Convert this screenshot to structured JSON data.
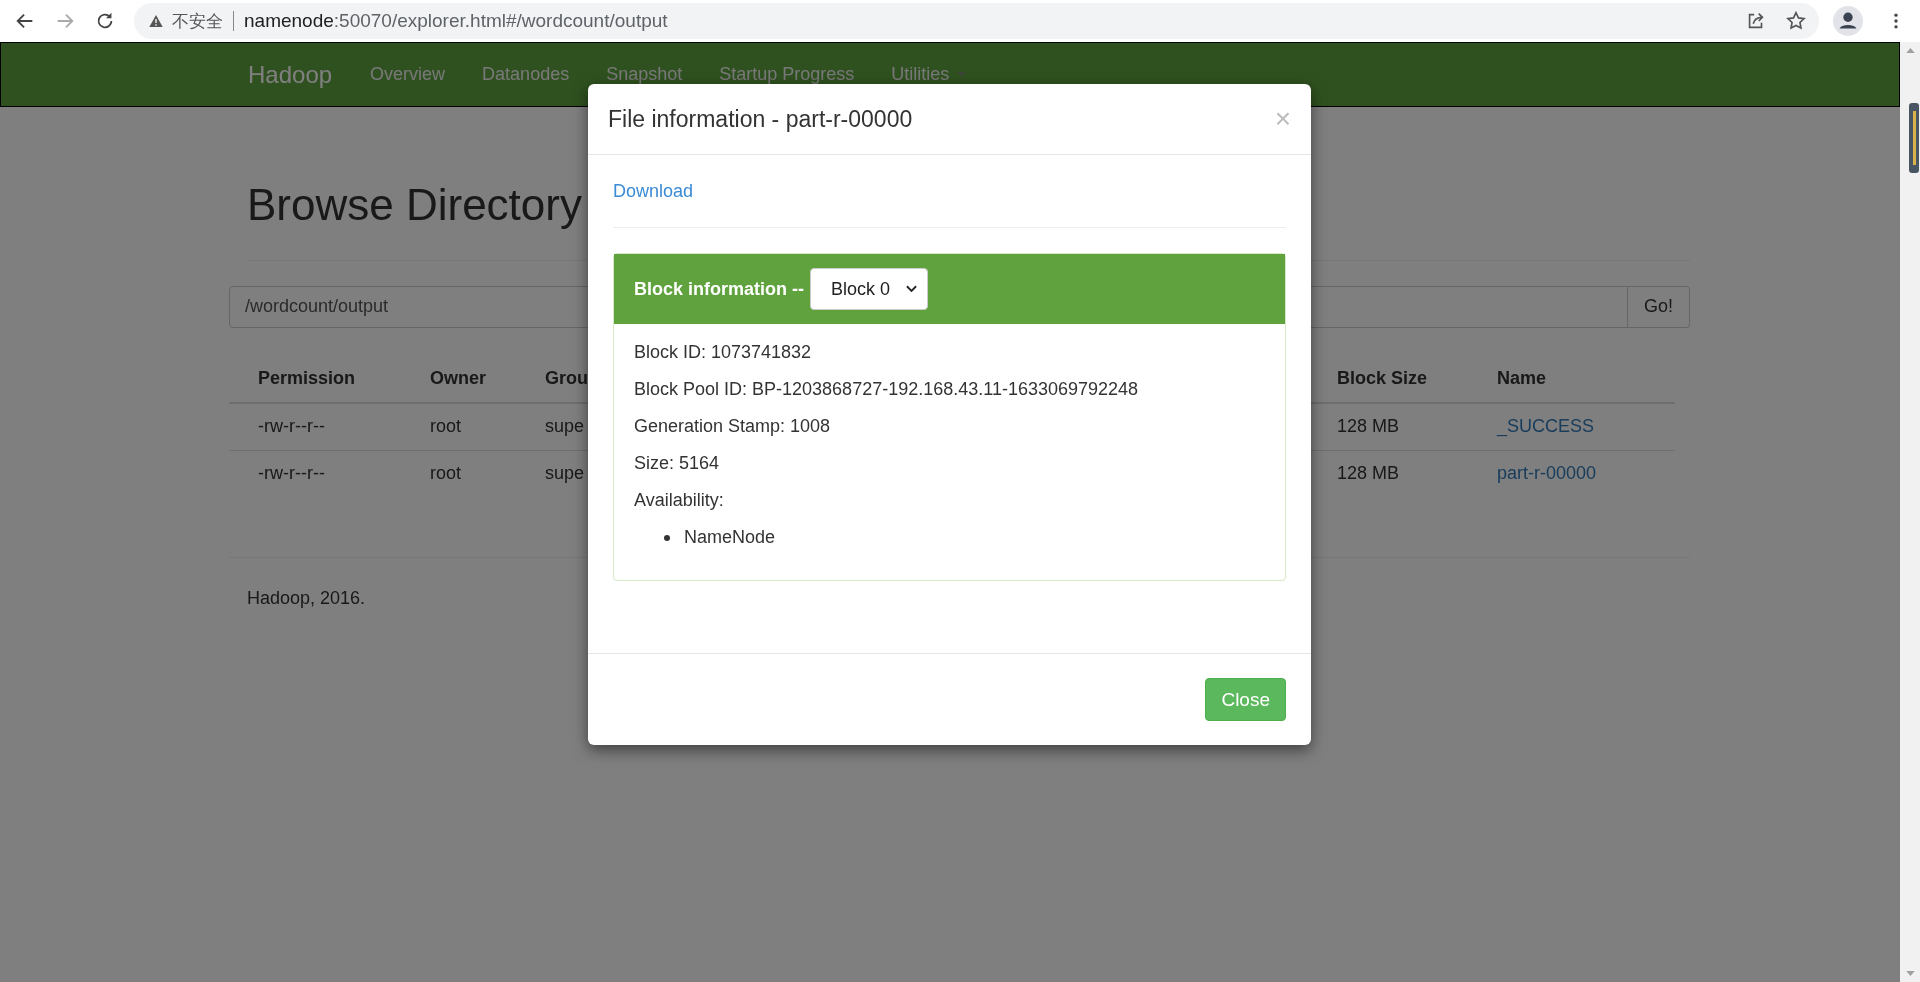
{
  "browser": {
    "security_label": "不安全",
    "url_host": "namenode",
    "url_rest": ":50070/explorer.html#/wordcount/output"
  },
  "navbar": {
    "brand": "Hadoop",
    "items": [
      {
        "label": "Overview",
        "dropdown": false
      },
      {
        "label": "Datanodes",
        "dropdown": false
      },
      {
        "label": "Snapshot",
        "dropdown": false
      },
      {
        "label": "Startup Progress",
        "dropdown": false
      },
      {
        "label": "Utilities",
        "dropdown": true
      }
    ]
  },
  "page": {
    "title": "Browse Directory",
    "path_value": "/wordcount/output",
    "go_button": "Go!",
    "table": {
      "columns": [
        "Permission",
        "Owner",
        "Grou",
        "Block Size",
        "Name"
      ],
      "rows": [
        {
          "cells": [
            "-rw-r--r--",
            "root",
            "supe",
            "128 MB",
            "_SUCCESS"
          ]
        },
        {
          "cells": [
            "-rw-r--r--",
            "root",
            "supe",
            "128 MB",
            "part-r-00000"
          ]
        }
      ]
    },
    "footer": "Hadoop, 2016."
  },
  "modal": {
    "title": "File information - part-r-00000",
    "close_icon": "×",
    "download_link": "Download",
    "block_panel": {
      "heading": "Block information --",
      "block_select": "Block 0",
      "details": [
        "Block ID: 1073741832",
        "Block Pool ID: BP-1203868727-192.168.43.11-1633069792248",
        "Generation Stamp: 1008",
        "Size: 5164"
      ],
      "availability_label": "Availability:",
      "availability": [
        "NameNode"
      ]
    },
    "close_button": "Close"
  }
}
